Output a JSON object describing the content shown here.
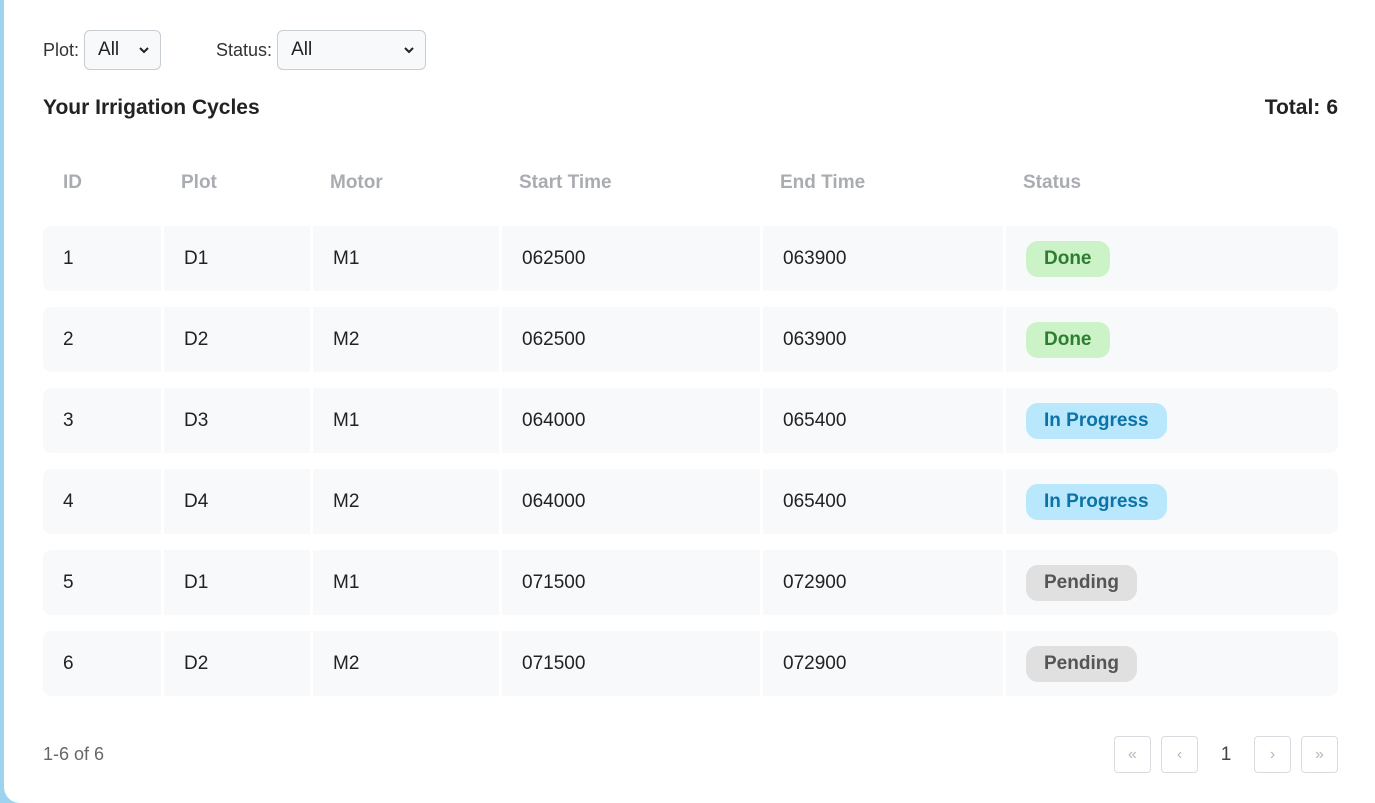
{
  "filters": {
    "plot_label": "Plot:",
    "plot_value": "All",
    "status_label": "Status:",
    "status_value": "All"
  },
  "section": {
    "title": "Your Irrigation Cycles",
    "total_label": "Total:",
    "total_value": "6"
  },
  "table": {
    "headers": [
      "ID",
      "Plot",
      "Motor",
      "Start Time",
      "End Time",
      "Status"
    ],
    "rows": [
      {
        "id": "1",
        "plot": "D1",
        "motor": "M1",
        "start": "062500",
        "end": "063900",
        "status": "Done"
      },
      {
        "id": "2",
        "plot": "D2",
        "motor": "M2",
        "start": "062500",
        "end": "063900",
        "status": "Done"
      },
      {
        "id": "3",
        "plot": "D3",
        "motor": "M1",
        "start": "064000",
        "end": "065400",
        "status": "In Progress"
      },
      {
        "id": "4",
        "plot": "D4",
        "motor": "M2",
        "start": "064000",
        "end": "065400",
        "status": "In Progress"
      },
      {
        "id": "5",
        "plot": "D1",
        "motor": "M1",
        "start": "071500",
        "end": "072900",
        "status": "Pending"
      },
      {
        "id": "6",
        "plot": "D2",
        "motor": "M2",
        "start": "071500",
        "end": "072900",
        "status": "Pending"
      }
    ]
  },
  "footer": {
    "count_text": "1-6 of 6",
    "first_label": "«",
    "prev_label": "‹",
    "page": "1",
    "next_label": "›",
    "last_label": "»"
  },
  "colors": {
    "done_bg": "#ccf3c7",
    "in_progress_bg": "#b9e7fb",
    "pending_bg": "#e0e0e0",
    "accent_edge": "#9ed3ef"
  }
}
